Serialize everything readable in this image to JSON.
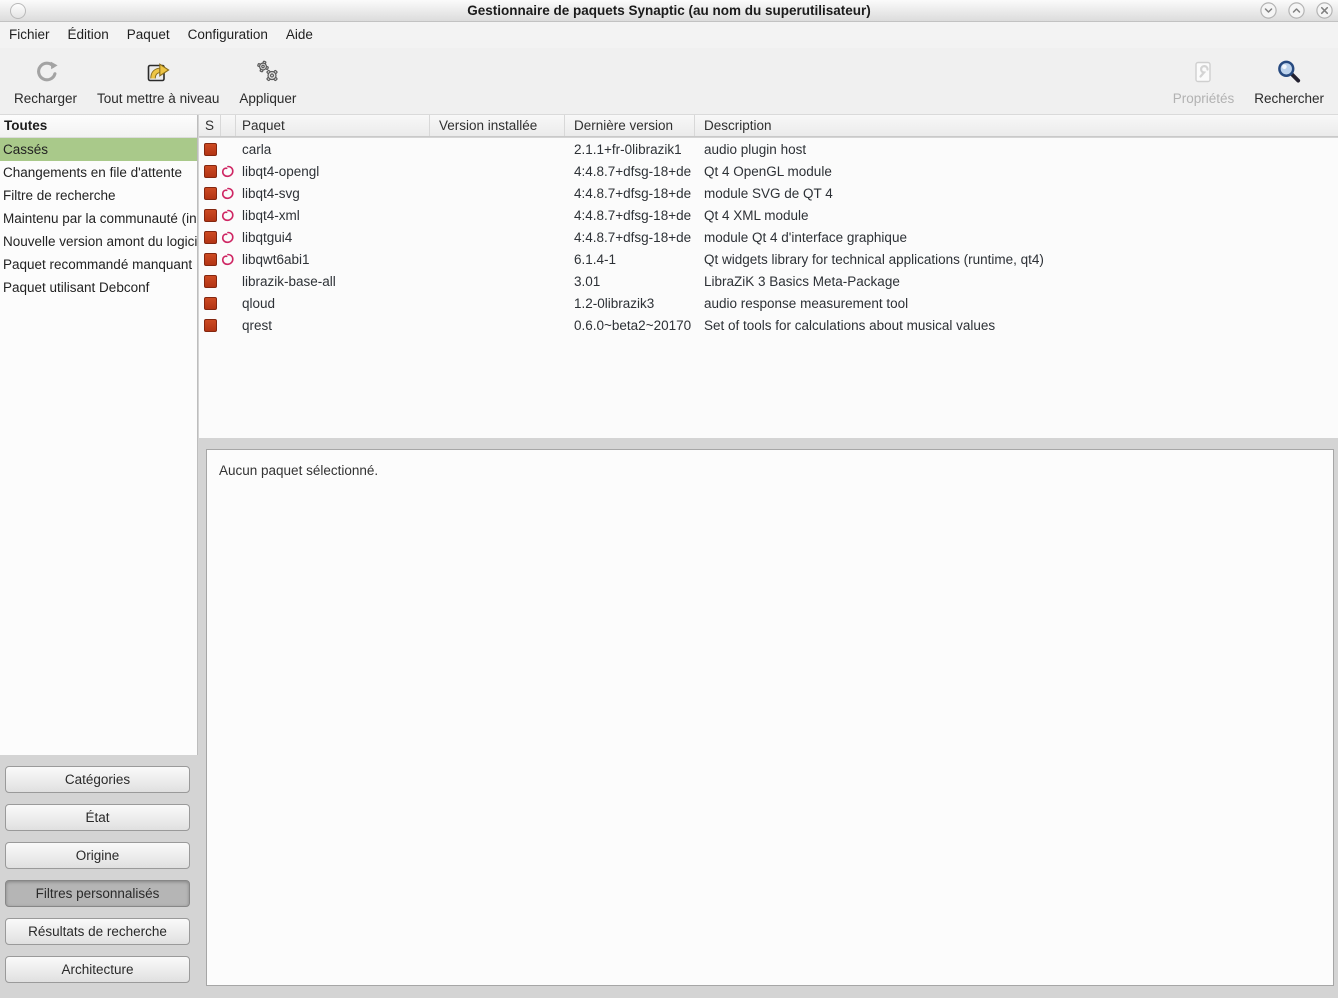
{
  "window": {
    "title": "Gestionnaire de paquets Synaptic (au nom du superutilisateur)"
  },
  "menubar": {
    "items": [
      "Fichier",
      "Édition",
      "Paquet",
      "Configuration",
      "Aide"
    ]
  },
  "toolbar": {
    "reload_label": "Recharger",
    "upgrade_all_label": "Tout mettre à niveau",
    "apply_label": "Appliquer",
    "properties_label": "Propriétés",
    "search_label": "Rechercher"
  },
  "sidebar": {
    "header": "Toutes",
    "items": [
      {
        "label": "Cassés",
        "selected": true
      },
      {
        "label": "Changements en file d'attente",
        "selected": false
      },
      {
        "label": "Filtre de recherche",
        "selected": false
      },
      {
        "label": "Maintenu par la communauté (installés)",
        "selected": false
      },
      {
        "label": "Nouvelle version amont du logiciel",
        "selected": false
      },
      {
        "label": "Paquet recommandé manquant",
        "selected": false
      },
      {
        "label": "Paquet utilisant Debconf",
        "selected": false
      }
    ],
    "filter_buttons": [
      {
        "label": "Catégories",
        "active": false
      },
      {
        "label": "État",
        "active": false
      },
      {
        "label": "Origine",
        "active": false
      },
      {
        "label": "Filtres personnalisés",
        "active": true
      },
      {
        "label": "Résultats de recherche",
        "active": false
      },
      {
        "label": "Architecture",
        "active": false
      }
    ]
  },
  "table": {
    "columns": [
      "S",
      "",
      "Paquet",
      "Version installée",
      "Dernière version",
      "Description"
    ],
    "rows": [
      {
        "status": "broken",
        "debian": false,
        "package": "carla",
        "installed": "",
        "latest": "2.1.1+fr-0librazik1",
        "description": "audio plugin host"
      },
      {
        "status": "broken",
        "debian": true,
        "package": "libqt4-opengl",
        "installed": "",
        "latest": "4:4.8.7+dfsg-18+de",
        "description": "Qt 4 OpenGL module"
      },
      {
        "status": "broken",
        "debian": true,
        "package": "libqt4-svg",
        "installed": "",
        "latest": "4:4.8.7+dfsg-18+de",
        "description": "module SVG de QT 4"
      },
      {
        "status": "broken",
        "debian": true,
        "package": "libqt4-xml",
        "installed": "",
        "latest": "4:4.8.7+dfsg-18+de",
        "description": "Qt 4 XML module"
      },
      {
        "status": "broken",
        "debian": true,
        "package": "libqtgui4",
        "installed": "",
        "latest": "4:4.8.7+dfsg-18+de",
        "description": "module Qt 4 d'interface graphique"
      },
      {
        "status": "broken",
        "debian": true,
        "package": "libqwt6abi1",
        "installed": "",
        "latest": "6.1.4-1",
        "description": "Qt widgets library for technical applications (runtime, qt4)"
      },
      {
        "status": "broken",
        "debian": false,
        "package": "librazik-base-all",
        "installed": "",
        "latest": "3.01",
        "description": "LibraZiK 3 Basics Meta-Package"
      },
      {
        "status": "broken",
        "debian": false,
        "package": "qloud",
        "installed": "",
        "latest": "1.2-0librazik3",
        "description": "audio response measurement tool"
      },
      {
        "status": "broken",
        "debian": false,
        "package": "qrest",
        "installed": "",
        "latest": "0.6.0~beta2~20170",
        "description": "Set of tools for calculations about musical values"
      }
    ]
  },
  "details_panel": {
    "message": "Aucun paquet sélectionné."
  },
  "colors": {
    "selection_green": "#a9c98a",
    "broken_red": "#c2411c",
    "debian_pink": "#ce2663",
    "search_blue": "#274a80"
  }
}
